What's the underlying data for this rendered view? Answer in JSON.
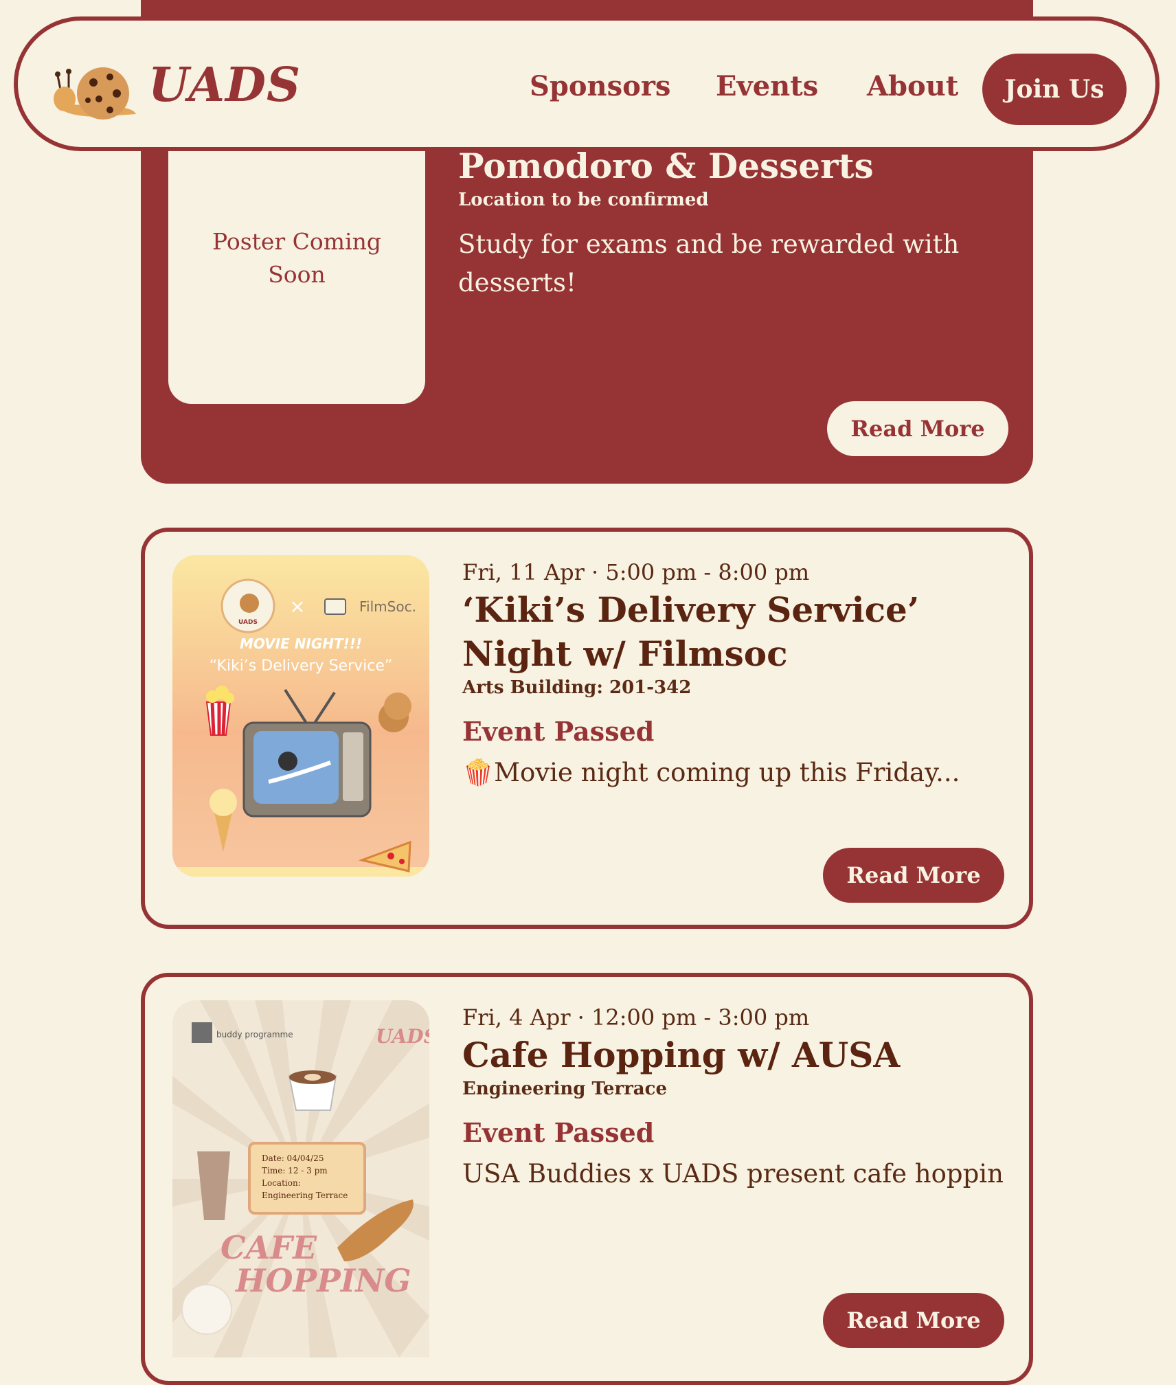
{
  "nav": {
    "brand": "UADS",
    "links": [
      "Sponsors",
      "Events",
      "About"
    ],
    "join_label": "Join Us"
  },
  "events": [
    {
      "title": "Pomodoro & Desserts",
      "location": "Location to be confirmed",
      "description": "Study for exams and be rewarded with desserts!",
      "poster_text": "Poster Coming Soon",
      "read_more": "Read More"
    },
    {
      "date": "Fri, 11 Apr · 5:00 pm - 8:00 pm",
      "title": "‘Kiki’s Delivery Service’ Night w/ Filmsoc",
      "location": "Arts Building: 201-342",
      "status": "Event Passed",
      "description": "🍿Movie night coming up this Friday...",
      "read_more": "Read More",
      "poster": {
        "logo": "UADS",
        "partner": "FilmSoc.",
        "heading": "MOVIE NIGHT!!!",
        "subheading": "“Kiki’s Delivery Service”"
      }
    },
    {
      "date": "Fri, 4 Apr · 12:00 pm - 3:00 pm",
      "title": "Cafe Hopping w/ AUSA",
      "location": "Engineering Terrace",
      "status": "Event Passed",
      "description": " USA Buddies x UADS present cafe hopping ...",
      "read_more": "Read More",
      "poster": {
        "partner": "buddy programme",
        "logo": "UADS",
        "ticket_date": "Date: 04/04/25",
        "ticket_time": "Time: 12 - 3 pm",
        "ticket_location_label": "Location:",
        "ticket_location": "Engineering Terrace",
        "heading_1": "CAFE",
        "heading_2": "HOPPING"
      }
    }
  ],
  "colors": {
    "primary": "#963335",
    "background": "#f8f2e2",
    "text_dark": "#5a2410"
  }
}
